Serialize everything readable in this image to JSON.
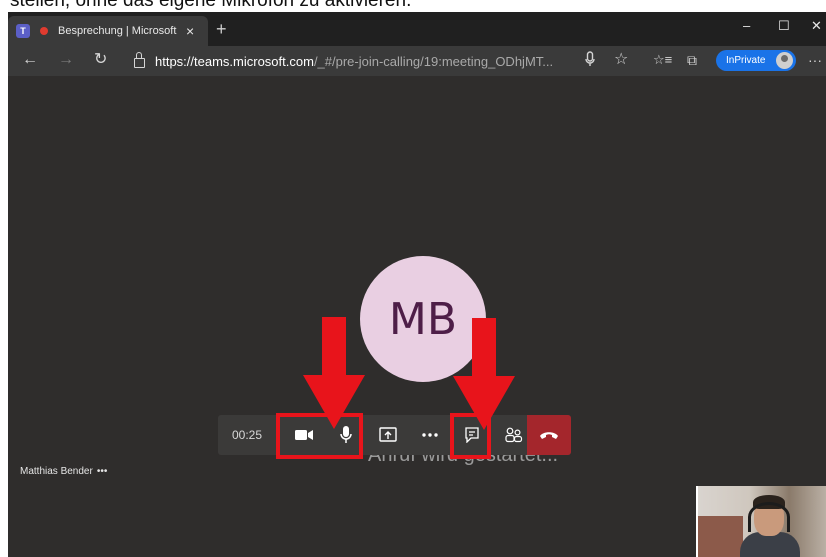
{
  "caption": "stellen, ohne das eigene Mikrofon zu aktivieren.",
  "browser": {
    "tab": {
      "title": "Besprechung | Microsoft Teams",
      "close": "×"
    },
    "new_tab": "+",
    "window_controls": {
      "minimize": "–",
      "maximize": "☐",
      "close": "✕"
    },
    "nav": {
      "back": "←",
      "forward": "→",
      "refresh": "↻"
    },
    "url": {
      "host": "https://teams.microsoft.com",
      "path": "/_#/pre-join-calling/19:meeting_ODhjMT..."
    },
    "toolbar": {
      "read_aloud": "🎙",
      "favorite": "☆",
      "favorites": "☆≡",
      "collections": "⧉",
      "more": "···"
    },
    "inprivate_label": "InPrivate"
  },
  "meeting": {
    "avatar_initials": "MB",
    "status_text": "Anruf wird gestartet...",
    "participant_name": "Matthias Bender",
    "participant_more": "•••",
    "timer": "00:25"
  },
  "annotation_color": "#e8141b",
  "accent_colors": {
    "hangup": "#a4262c",
    "inprivate": "#1a73e8",
    "avatar_bg": "#e9cfe2"
  }
}
